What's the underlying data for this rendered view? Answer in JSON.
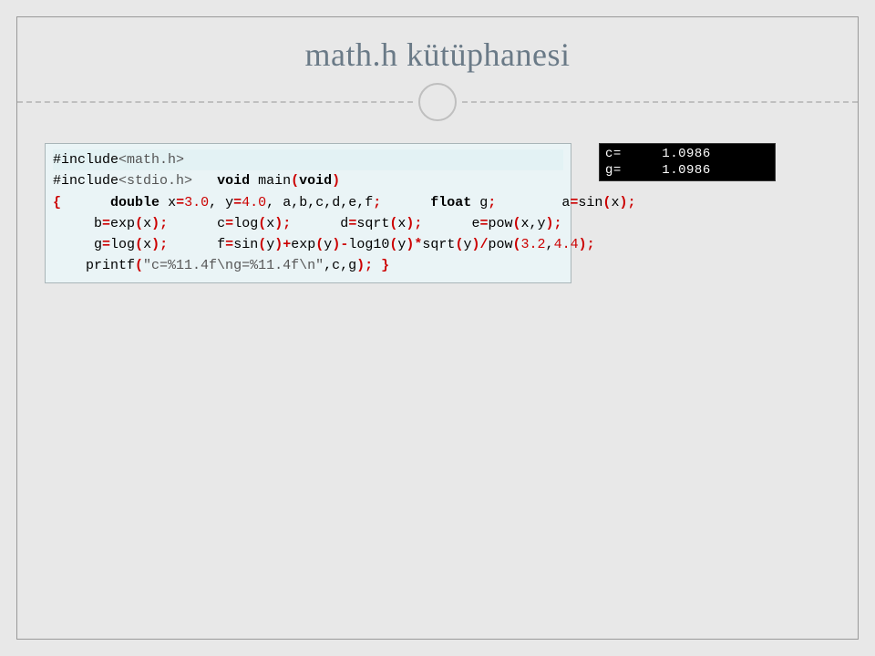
{
  "title": "math.h kütüphanesi",
  "code": {
    "l1a": "#include",
    "l1b": "<math.h>",
    "l2a": "#include",
    "l2b": "<stdio.h>",
    "sig_void1": "void",
    "sig_main": " main",
    "sig_par_o": "(",
    "sig_void2": "void",
    "sig_par_c": ")",
    "brace_o": "{",
    "decl1_kw": "double",
    "decl1_rest": " x",
    "eq": "=",
    "v30": "3.0",
    "comma": ",",
    "y": " y",
    "v40": "4.0",
    "decl1_tail": " a,b,c,d,e,f",
    "semi": ";",
    "decl2_kw": "float",
    "decl2_rest": " g",
    "a_lhs": "a",
    "sin": "sin",
    "lp": "(",
    "x": "x",
    "rp": ")",
    "b_lhs": "b",
    "exp": "exp",
    "c_lhs": "c",
    "log": "log",
    "d_lhs": "d",
    "sqrt": "sqrt",
    "e_lhs": "e",
    "pow": "pow",
    "xy": "x,y",
    "g_lhs": "g",
    "f_lhs": "f",
    "y_var": "y",
    "plus": "+",
    "minus": "-",
    "log10": "log10",
    "star": "*",
    "slash": "/",
    "v32": "3.2",
    "v44": "4.4",
    "printf": "printf",
    "fmt": "\"c=%11.4f\\ng=%11.4f\\n\"",
    "args": ",c,g",
    "brace_c": "}"
  },
  "console": {
    "line1": "c=     1.0986",
    "line2": "g=     1.0986"
  }
}
